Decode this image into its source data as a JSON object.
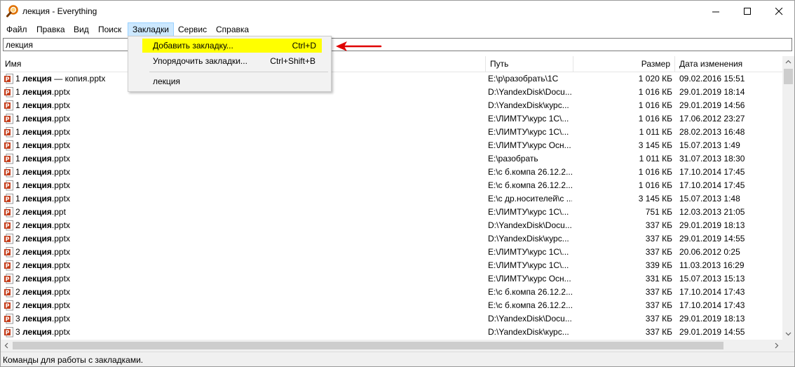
{
  "window": {
    "title": "лекция - Everything"
  },
  "menu": [
    "Файл",
    "Правка",
    "Вид",
    "Поиск",
    "Закладки",
    "Сервис",
    "Справка"
  ],
  "search": {
    "value": "лекция"
  },
  "columns": {
    "name": "Имя",
    "path": "Путь",
    "size": "Размер",
    "date": "Дата изменения"
  },
  "dropdown": {
    "items": [
      {
        "label": "Добавить закладку...",
        "shortcut": "Ctrl+D"
      },
      {
        "label": "Упорядочить закладки...",
        "shortcut": "Ctrl+Shift+B"
      },
      {
        "label": "лекция",
        "shortcut": ""
      }
    ]
  },
  "rows": [
    {
      "prefix": "1 ",
      "bold": "лекция",
      "suffix": " — копия.pptx",
      "path": "E:\\р\\разобрать\\1С",
      "size": "1 020 КБ",
      "date": "09.02.2016 15:51",
      "icon": "pptx"
    },
    {
      "prefix": "1 ",
      "bold": "лекция",
      "suffix": ".pptx",
      "path": "D:\\YandexDisk\\Docu...",
      "size": "1 016 КБ",
      "date": "29.01.2019 18:14",
      "icon": "pptx"
    },
    {
      "prefix": "1 ",
      "bold": "лекция",
      "suffix": ".pptx",
      "path": "D:\\YandexDisk\\курс...",
      "size": "1 016 КБ",
      "date": "29.01.2019 14:56",
      "icon": "pptx"
    },
    {
      "prefix": "1 ",
      "bold": "лекция",
      "suffix": ".pptx",
      "path": "E:\\ЛИМТУ\\курс 1С\\...",
      "size": "1 016 КБ",
      "date": "17.06.2012 23:27",
      "icon": "pptx"
    },
    {
      "prefix": "1 ",
      "bold": "лекция",
      "suffix": ".pptx",
      "path": "E:\\ЛИМТУ\\курс 1С\\...",
      "size": "1 011 КБ",
      "date": "28.02.2013 16:48",
      "icon": "pptx"
    },
    {
      "prefix": "1 ",
      "bold": "лекция",
      "suffix": ".pptx",
      "path": "E:\\ЛИМТУ\\курс Осн...",
      "size": "3 145 КБ",
      "date": "15.07.2013 1:49",
      "icon": "pptx"
    },
    {
      "prefix": "1 ",
      "bold": "лекция",
      "suffix": ".pptx",
      "path": "E:\\разобрать",
      "size": "1 011 КБ",
      "date": "31.07.2013 18:30",
      "icon": "pptx"
    },
    {
      "prefix": "1 ",
      "bold": "лекция",
      "suffix": ".pptx",
      "path": "E:\\с б.компа 26.12.2...",
      "size": "1 016 КБ",
      "date": "17.10.2014 17:45",
      "icon": "pptx"
    },
    {
      "prefix": "1 ",
      "bold": "лекция",
      "suffix": ".pptx",
      "path": "E:\\с б.компа 26.12.2...",
      "size": "1 016 КБ",
      "date": "17.10.2014 17:45",
      "icon": "pptx"
    },
    {
      "prefix": "1 ",
      "bold": "лекция",
      "suffix": ".pptx",
      "path": "E:\\с др.носителей\\с ...",
      "size": "3 145 КБ",
      "date": "15.07.2013 1:48",
      "icon": "pptx"
    },
    {
      "prefix": "2 ",
      "bold": "лекция",
      "suffix": ".ppt",
      "path": "E:\\ЛИМТУ\\курс 1С\\...",
      "size": "751 КБ",
      "date": "12.03.2013 21:05",
      "icon": "ppt"
    },
    {
      "prefix": "2 ",
      "bold": "лекция",
      "suffix": ".pptx",
      "path": "D:\\YandexDisk\\Docu...",
      "size": "337 КБ",
      "date": "29.01.2019 18:13",
      "icon": "pptx"
    },
    {
      "prefix": "2 ",
      "bold": "лекция",
      "suffix": ".pptx",
      "path": "D:\\YandexDisk\\курс...",
      "size": "337 КБ",
      "date": "29.01.2019 14:55",
      "icon": "pptx"
    },
    {
      "prefix": "2 ",
      "bold": "лекция",
      "suffix": ".pptx",
      "path": "E:\\ЛИМТУ\\курс 1С\\...",
      "size": "337 КБ",
      "date": "20.06.2012 0:25",
      "icon": "pptx"
    },
    {
      "prefix": "2 ",
      "bold": "лекция",
      "suffix": ".pptx",
      "path": "E:\\ЛИМТУ\\курс 1С\\...",
      "size": "339 КБ",
      "date": "11.03.2013 16:29",
      "icon": "pptx"
    },
    {
      "prefix": "2 ",
      "bold": "лекция",
      "suffix": ".pptx",
      "path": "E:\\ЛИМТУ\\курс Осн...",
      "size": "331 КБ",
      "date": "15.07.2013 15:13",
      "icon": "pptx"
    },
    {
      "prefix": "2 ",
      "bold": "лекция",
      "suffix": ".pptx",
      "path": "E:\\с б.компа 26.12.2...",
      "size": "337 КБ",
      "date": "17.10.2014 17:43",
      "icon": "pptx"
    },
    {
      "prefix": "2 ",
      "bold": "лекция",
      "suffix": ".pptx",
      "path": "E:\\с б.компа 26.12.2...",
      "size": "337 КБ",
      "date": "17.10.2014 17:43",
      "icon": "pptx"
    },
    {
      "prefix": "3 ",
      "bold": "лекция",
      "suffix": ".pptx",
      "path": "D:\\YandexDisk\\Docu...",
      "size": "337 КБ",
      "date": "29.01.2019 18:13",
      "icon": "pptx"
    },
    {
      "prefix": "3 ",
      "bold": "лекция",
      "suffix": ".pptx",
      "path": "D:\\YandexDisk\\курс...",
      "size": "337 КБ",
      "date": "29.01.2019 14:55",
      "icon": "pptx"
    }
  ],
  "status": {
    "text": "Команды для работы с закладками."
  },
  "colors": {
    "highlight": "#ffff00",
    "menu_active": "#cce8ff",
    "ppt_icon": "#c43e1c",
    "arrow": "#e00000"
  },
  "icons": {
    "app": "magnifier-icon",
    "file": "powerpoint-file-icon"
  }
}
